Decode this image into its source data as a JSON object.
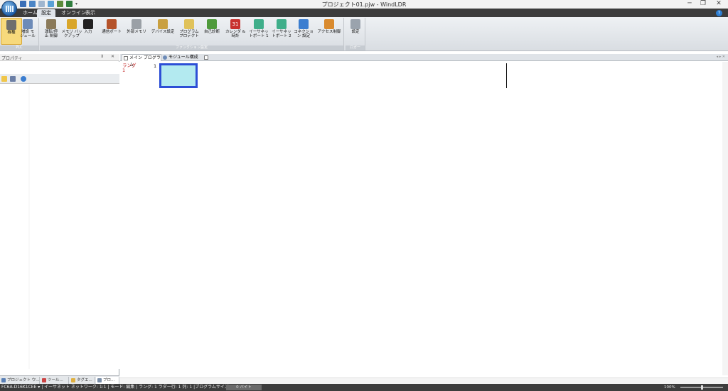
{
  "window": {
    "title": "プロジェクト01.pjw - WindLDR",
    "minimize_glyph": "─",
    "restore_glyph": "❐",
    "close_glyph": "✕"
  },
  "ribbon_tabs": [
    {
      "label": "ホーム"
    },
    {
      "label": "設定"
    },
    {
      "label": "オンライン"
    },
    {
      "label": "表示"
    }
  ],
  "active_tab": "設定",
  "help_glyph": "?",
  "ribbon": {
    "groups": [
      {
        "label": "PLC"
      },
      {
        "label": "ファンクション設定"
      },
      {
        "label": "ロガー"
      }
    ],
    "buttons": [
      {
        "label": "機種",
        "icon": "plc-model-icon",
        "color": "#6e6e6e"
      },
      {
        "label": "増設 モ\nジュール",
        "icon": "expansion-module-icon",
        "color": "#6d8bb8"
      },
      {
        "label": "運転/停\n止 制御",
        "icon": "run-stop-icon",
        "color": "#8a7a5a"
      },
      {
        "label": "メモリ バッ\nクアップ",
        "icon": "memory-backup-icon",
        "color": "#d9a62a"
      },
      {
        "label": "入力",
        "icon": "input-icon",
        "color": "#222222"
      },
      {
        "label": "通信ポート",
        "icon": "comm-port-icon",
        "color": "#b5532a"
      },
      {
        "label": "外部メモリ",
        "icon": "external-memory-icon",
        "color": "#9aa0a6"
      },
      {
        "label": "デバイス設定",
        "icon": "device-settings-icon",
        "color": "#c9a040"
      },
      {
        "label": "プログラム\nプロテクト",
        "icon": "program-protect-icon",
        "color": "#e0c25a"
      },
      {
        "label": "自己診断",
        "icon": "self-diagnosis-icon",
        "color": "#4f9a3c"
      },
      {
        "label": "カレンダ &\n時計",
        "icon": "calendar-clock-icon",
        "color": "#c8322e"
      },
      {
        "label": "イーサネッ\nトポート 1",
        "icon": "ethernet-port-1-icon",
        "color": "#3fae8a"
      },
      {
        "label": "イーサネッ\nトポート 2",
        "icon": "ethernet-port-2-icon",
        "color": "#3fae8a"
      },
      {
        "label": "コネクショ\nン 設定",
        "icon": "connection-settings-icon",
        "color": "#3b7ed0"
      },
      {
        "label": "アクセス制御",
        "icon": "access-control-icon",
        "color": "#d98a2e"
      },
      {
        "label": "設定",
        "icon": "logger-settings-icon",
        "color": "#9aa3ad"
      }
    ],
    "selected_button": "機種"
  },
  "left_panel": {
    "title": "プロパティ",
    "header_buttons": "⇕ ✕",
    "toolbar_icons": [
      "categorized-icon",
      "sort-az-icon",
      "help-icon"
    ],
    "bottom_tabs": [
      {
        "label": "プロジェクト ウ...",
        "icon": "project-window-icon"
      },
      {
        "label": "ツール...",
        "icon": "toolbox-icon"
      },
      {
        "label": "タグエ...",
        "icon": "tag-editor-icon"
      },
      {
        "label": "プロ...",
        "icon": "properties-icon"
      }
    ],
    "active_tab_index": 3
  },
  "editor": {
    "tabs": [
      {
        "label": "メイン プログラム",
        "icon": "main-program-icon"
      },
      {
        "label": "モジュール構成",
        "icon": "module-config-icon"
      },
      {
        "label": "",
        "icon": "new-tab-icon"
      }
    ],
    "right_controls": "◂ ▸ ✕",
    "rung_label": "ラング",
    "rung_index": "1",
    "line_number": "1"
  },
  "status_bar": {
    "text": "FC6A-D16K1CEE  ▾  |  イーサネット  ネットワーク: 1:1  |  モード: 編集  |  ラング: 1  ラダー行: 1  列: 1  |プログラムサイズ:",
    "program_size": "0 バイト",
    "zoom": "100%"
  },
  "colors": {
    "accent": "#2d4fd6",
    "cursor_fill": "#b3eaf0",
    "rung_label": "#c02020",
    "selected_button": "#f7d97c"
  }
}
